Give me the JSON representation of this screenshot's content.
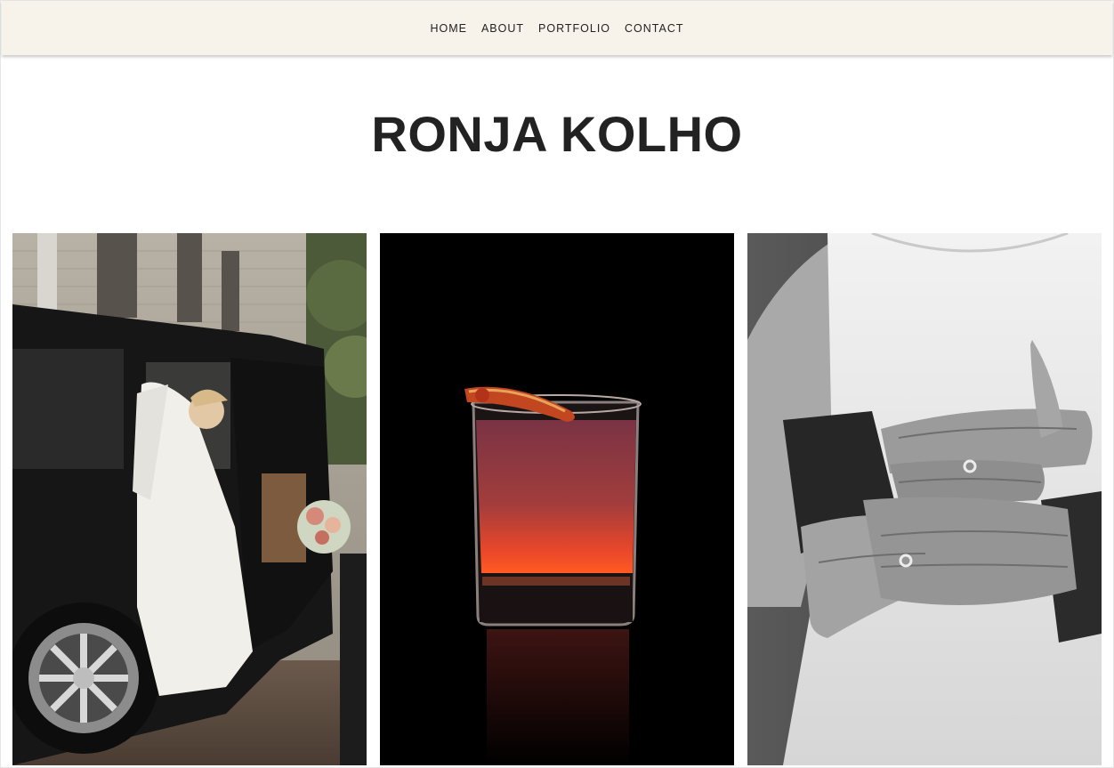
{
  "nav": {
    "items": [
      "HOME",
      "ABOUT",
      "PORTFOLIO",
      "CONTACT"
    ]
  },
  "site_title": "RONJA KOLHO",
  "gallery": {
    "photos": [
      {
        "subject": "bride-exiting-car-photo"
      },
      {
        "subject": "cocktail-glass-photo"
      },
      {
        "subject": "wedding-hands-rings-photo"
      }
    ]
  },
  "colors": {
    "nav_background": "#f8f3ea",
    "title_text": "#222222",
    "page_background": "#ffffff"
  }
}
